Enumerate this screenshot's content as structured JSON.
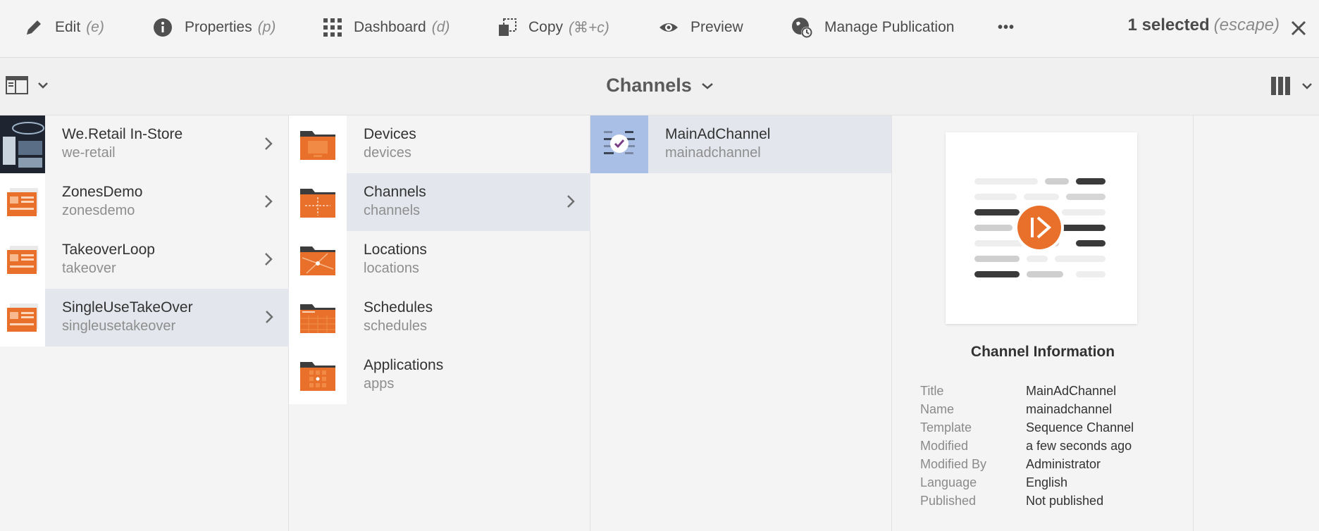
{
  "toolbar": {
    "edit": {
      "label": "Edit",
      "shortcut": "(e)"
    },
    "properties": {
      "label": "Properties",
      "shortcut": "(p)"
    },
    "dashboard": {
      "label": "Dashboard",
      "shortcut": "(d)"
    },
    "copy": {
      "label": "Copy",
      "shortcut": "(⌘+c)"
    },
    "preview": {
      "label": "Preview"
    },
    "manage": {
      "label": "Manage Publication"
    },
    "more": "•••",
    "selected": "1 selected",
    "escape": "(escape)"
  },
  "breadcrumb": {
    "title": "Channels"
  },
  "columns": {
    "projects": [
      {
        "title": "We.Retail In-Store",
        "name": "we-retail"
      },
      {
        "title": "ZonesDemo",
        "name": "zonesdemo"
      },
      {
        "title": "TakeoverLoop",
        "name": "takeover"
      },
      {
        "title": "SingleUseTakeOver",
        "name": "singleusetakeover"
      }
    ],
    "folders": [
      {
        "title": "Devices",
        "name": "devices"
      },
      {
        "title": "Channels",
        "name": "channels"
      },
      {
        "title": "Locations",
        "name": "locations"
      },
      {
        "title": "Schedules",
        "name": "schedules"
      },
      {
        "title": "Applications",
        "name": "apps"
      }
    ],
    "channels": [
      {
        "title": "MainAdChannel",
        "name": "mainadchannel"
      }
    ]
  },
  "info": {
    "heading": "Channel Information",
    "rows": [
      {
        "label": "Title",
        "value": "MainAdChannel"
      },
      {
        "label": "Name",
        "value": "mainadchannel"
      },
      {
        "label": "Template",
        "value": "Sequence Channel"
      },
      {
        "label": "Modified",
        "value": "a few seconds ago"
      },
      {
        "label": "Modified By",
        "value": "Administrator"
      },
      {
        "label": "Language",
        "value": "English"
      },
      {
        "label": "Published",
        "value": "Not published"
      }
    ]
  },
  "colors": {
    "accent": "#e8702a",
    "selected_row": "#e3e6ec",
    "selected_thumb": "#a9bfe6"
  }
}
